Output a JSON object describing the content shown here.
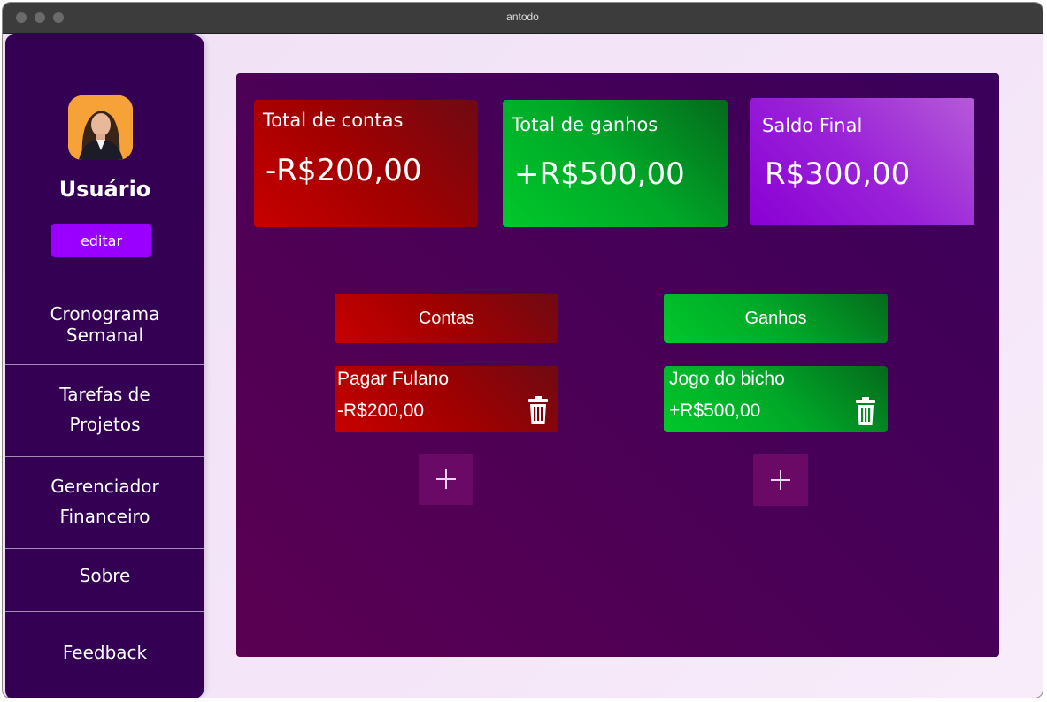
{
  "window": {
    "title": "antodo"
  },
  "sidebar": {
    "username": "Usuário",
    "edit_label": "editar",
    "nav": [
      {
        "line1": "Cronograma",
        "line2": "Semanal"
      },
      {
        "line1": "Tarefas de",
        "line2": "Projetos"
      },
      {
        "line1": "Gerenciador",
        "line2": "Financeiro"
      },
      {
        "line1": "Sobre",
        "line2": ""
      },
      {
        "line1": "Feedback",
        "line2": ""
      }
    ]
  },
  "summary": {
    "contas": {
      "label": "Total de contas",
      "value": "-R$200,00"
    },
    "ganhos": {
      "label": "Total de ganhos",
      "value": "+R$500,00"
    },
    "saldo": {
      "label": "Saldo Final",
      "value": "R$300,00"
    }
  },
  "columns": {
    "contas": {
      "header": "Contas",
      "items": [
        {
          "name": "Pagar Fulano",
          "amount": "-R$200,00"
        }
      ]
    },
    "ganhos": {
      "header": "Ganhos",
      "items": [
        {
          "name": "Jogo do bicho",
          "amount": "+R$500,00"
        }
      ]
    }
  },
  "icons": {
    "avatar": "user-avatar",
    "delete": "trash-icon",
    "add": "plus-icon"
  },
  "colors": {
    "sidebar": "#330054",
    "edit_button": "#9a00ff",
    "red": "#c80000",
    "green": "#00c82a",
    "purple": "#8a00d4"
  }
}
